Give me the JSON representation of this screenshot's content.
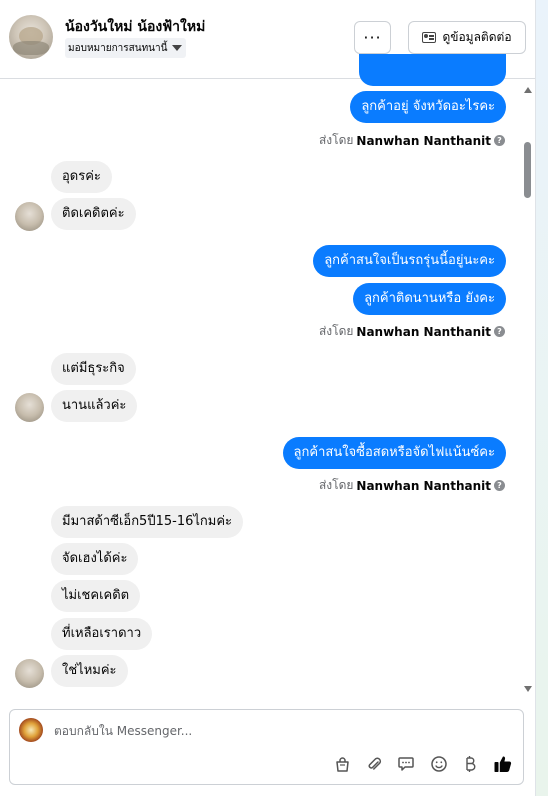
{
  "header": {
    "page_name": "น้องวันใหม่ น้องฟ้าใหม่",
    "assign_label": "มอบหมายการสนทนานี้",
    "more_label": "···",
    "contact_label": "ดูข้อมูลติดต่อ"
  },
  "messages": [
    {
      "side": "out",
      "text": "ลูกค้าอยู่ จังหวัดอะไรคะ"
    },
    {
      "side": "sent_by",
      "prefix": "ส่งโดย",
      "name": "Nanwhan Nanthanit"
    },
    {
      "side": "in",
      "text": "อุดรค่ะ"
    },
    {
      "side": "in",
      "text": "ติดเคดิตค่ะ"
    },
    {
      "side": "out",
      "text": "ลูกค้าสนใจเป็นรถรุ่นนี้อยู่นะคะ"
    },
    {
      "side": "out",
      "text": "ลูกค้าติดนานหรือ ยังคะ"
    },
    {
      "side": "sent_by",
      "prefix": "ส่งโดย",
      "name": "Nanwhan Nanthanit"
    },
    {
      "side": "in",
      "text": "แต่มีธุระกิจ"
    },
    {
      "side": "in",
      "text": "นานแล้วค่ะ"
    },
    {
      "side": "out",
      "text": "ลูกค้าสนใจซื้อสดหรือจัดไฟแน้นซ์คะ"
    },
    {
      "side": "sent_by",
      "prefix": "ส่งโดย",
      "name": "Nanwhan Nanthanit"
    },
    {
      "side": "in",
      "text": "มีมาสด้าซีเอ็ก5ปี15-16ไกมค่ะ"
    },
    {
      "side": "in",
      "text": "จัดเฮงได้ค่ะ"
    },
    {
      "side": "in",
      "text": "ไม่เชคเคดิต"
    },
    {
      "side": "in",
      "text": "ที่เหลือเราดาว"
    },
    {
      "side": "in",
      "text": "ใช่ไหมค่ะ"
    }
  ],
  "composer": {
    "placeholder": "ตอบกลับใน Messenger..."
  },
  "colors": {
    "outgoing_bubble": "#0a7cff",
    "incoming_bubble": "#f0f0f0",
    "like": "#050505"
  },
  "toolbar_icons": [
    "shopping-bag-icon",
    "paperclip-icon",
    "speech-bubble-icon",
    "emoji-icon",
    "baht-icon",
    "thumbs-up-icon"
  ]
}
